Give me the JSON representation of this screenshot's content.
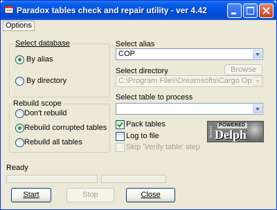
{
  "window": {
    "title": "Paradox tables check and repair utility - ver 4.42"
  },
  "menu": {
    "options_label": "Options"
  },
  "select_database": {
    "label": "Select database",
    "options": [
      {
        "label": "By alias",
        "selected": true
      },
      {
        "label": "By directory",
        "selected": false
      }
    ]
  },
  "rebuild_scope": {
    "label": "Rebuild scope",
    "options": [
      {
        "label": "Don't rebuild",
        "selected": false
      },
      {
        "label": "Rebuild corrupted tables",
        "selected": true
      },
      {
        "label": "Rebuild all tables",
        "selected": false
      }
    ]
  },
  "alias": {
    "label": "Select alias",
    "value": "COP"
  },
  "directory": {
    "label": "Select directory",
    "value": "C:\\Program Files\\Dreamsofts\\Cargo Optimizer\\D",
    "browse_label": "Browse"
  },
  "table": {
    "label": "Select table to process",
    "value": ""
  },
  "checkboxes": {
    "pack_tables": {
      "label": "Pack tables",
      "checked": true
    },
    "log_to_file": {
      "label": "Log to file",
      "checked": false
    },
    "skip_verify": {
      "label": "Skip 'Verify table' step",
      "checked": false,
      "disabled": true
    }
  },
  "badge": {
    "top": "POWERED BY",
    "main": "Delphi",
    "side": "Borland"
  },
  "status": {
    "text": "Ready",
    "progress": [
      0,
      0
    ]
  },
  "buttons": {
    "start": "Start",
    "stop": "Stop",
    "close": "Close"
  },
  "colors": {
    "title_bar": "#0054e3",
    "radio_dot": "#21a121",
    "button_border": "#003c74"
  }
}
